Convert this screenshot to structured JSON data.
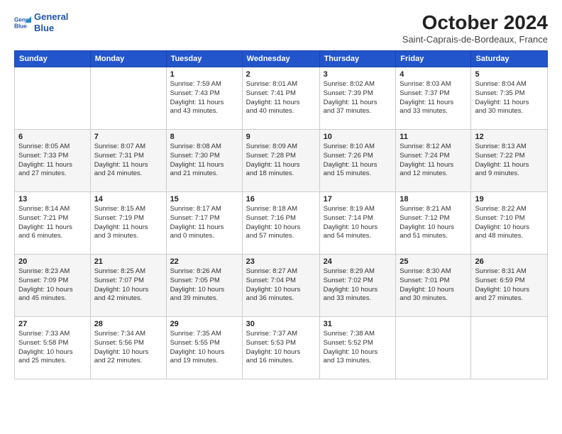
{
  "logo": {
    "line1": "General",
    "line2": "Blue"
  },
  "title": "October 2024",
  "location": "Saint-Caprais-de-Bordeaux, France",
  "weekdays": [
    "Sunday",
    "Monday",
    "Tuesday",
    "Wednesday",
    "Thursday",
    "Friday",
    "Saturday"
  ],
  "weeks": [
    [
      {
        "day": "",
        "info": ""
      },
      {
        "day": "",
        "info": ""
      },
      {
        "day": "1",
        "info": "Sunrise: 7:59 AM\nSunset: 7:43 PM\nDaylight: 11 hours\nand 43 minutes."
      },
      {
        "day": "2",
        "info": "Sunrise: 8:01 AM\nSunset: 7:41 PM\nDaylight: 11 hours\nand 40 minutes."
      },
      {
        "day": "3",
        "info": "Sunrise: 8:02 AM\nSunset: 7:39 PM\nDaylight: 11 hours\nand 37 minutes."
      },
      {
        "day": "4",
        "info": "Sunrise: 8:03 AM\nSunset: 7:37 PM\nDaylight: 11 hours\nand 33 minutes."
      },
      {
        "day": "5",
        "info": "Sunrise: 8:04 AM\nSunset: 7:35 PM\nDaylight: 11 hours\nand 30 minutes."
      }
    ],
    [
      {
        "day": "6",
        "info": "Sunrise: 8:05 AM\nSunset: 7:33 PM\nDaylight: 11 hours\nand 27 minutes."
      },
      {
        "day": "7",
        "info": "Sunrise: 8:07 AM\nSunset: 7:31 PM\nDaylight: 11 hours\nand 24 minutes."
      },
      {
        "day": "8",
        "info": "Sunrise: 8:08 AM\nSunset: 7:30 PM\nDaylight: 11 hours\nand 21 minutes."
      },
      {
        "day": "9",
        "info": "Sunrise: 8:09 AM\nSunset: 7:28 PM\nDaylight: 11 hours\nand 18 minutes."
      },
      {
        "day": "10",
        "info": "Sunrise: 8:10 AM\nSunset: 7:26 PM\nDaylight: 11 hours\nand 15 minutes."
      },
      {
        "day": "11",
        "info": "Sunrise: 8:12 AM\nSunset: 7:24 PM\nDaylight: 11 hours\nand 12 minutes."
      },
      {
        "day": "12",
        "info": "Sunrise: 8:13 AM\nSunset: 7:22 PM\nDaylight: 11 hours\nand 9 minutes."
      }
    ],
    [
      {
        "day": "13",
        "info": "Sunrise: 8:14 AM\nSunset: 7:21 PM\nDaylight: 11 hours\nand 6 minutes."
      },
      {
        "day": "14",
        "info": "Sunrise: 8:15 AM\nSunset: 7:19 PM\nDaylight: 11 hours\nand 3 minutes."
      },
      {
        "day": "15",
        "info": "Sunrise: 8:17 AM\nSunset: 7:17 PM\nDaylight: 11 hours\nand 0 minutes."
      },
      {
        "day": "16",
        "info": "Sunrise: 8:18 AM\nSunset: 7:16 PM\nDaylight: 10 hours\nand 57 minutes."
      },
      {
        "day": "17",
        "info": "Sunrise: 8:19 AM\nSunset: 7:14 PM\nDaylight: 10 hours\nand 54 minutes."
      },
      {
        "day": "18",
        "info": "Sunrise: 8:21 AM\nSunset: 7:12 PM\nDaylight: 10 hours\nand 51 minutes."
      },
      {
        "day": "19",
        "info": "Sunrise: 8:22 AM\nSunset: 7:10 PM\nDaylight: 10 hours\nand 48 minutes."
      }
    ],
    [
      {
        "day": "20",
        "info": "Sunrise: 8:23 AM\nSunset: 7:09 PM\nDaylight: 10 hours\nand 45 minutes."
      },
      {
        "day": "21",
        "info": "Sunrise: 8:25 AM\nSunset: 7:07 PM\nDaylight: 10 hours\nand 42 minutes."
      },
      {
        "day": "22",
        "info": "Sunrise: 8:26 AM\nSunset: 7:05 PM\nDaylight: 10 hours\nand 39 minutes."
      },
      {
        "day": "23",
        "info": "Sunrise: 8:27 AM\nSunset: 7:04 PM\nDaylight: 10 hours\nand 36 minutes."
      },
      {
        "day": "24",
        "info": "Sunrise: 8:29 AM\nSunset: 7:02 PM\nDaylight: 10 hours\nand 33 minutes."
      },
      {
        "day": "25",
        "info": "Sunrise: 8:30 AM\nSunset: 7:01 PM\nDaylight: 10 hours\nand 30 minutes."
      },
      {
        "day": "26",
        "info": "Sunrise: 8:31 AM\nSunset: 6:59 PM\nDaylight: 10 hours\nand 27 minutes."
      }
    ],
    [
      {
        "day": "27",
        "info": "Sunrise: 7:33 AM\nSunset: 5:58 PM\nDaylight: 10 hours\nand 25 minutes."
      },
      {
        "day": "28",
        "info": "Sunrise: 7:34 AM\nSunset: 5:56 PM\nDaylight: 10 hours\nand 22 minutes."
      },
      {
        "day": "29",
        "info": "Sunrise: 7:35 AM\nSunset: 5:55 PM\nDaylight: 10 hours\nand 19 minutes."
      },
      {
        "day": "30",
        "info": "Sunrise: 7:37 AM\nSunset: 5:53 PM\nDaylight: 10 hours\nand 16 minutes."
      },
      {
        "day": "31",
        "info": "Sunrise: 7:38 AM\nSunset: 5:52 PM\nDaylight: 10 hours\nand 13 minutes."
      },
      {
        "day": "",
        "info": ""
      },
      {
        "day": "",
        "info": ""
      }
    ]
  ]
}
